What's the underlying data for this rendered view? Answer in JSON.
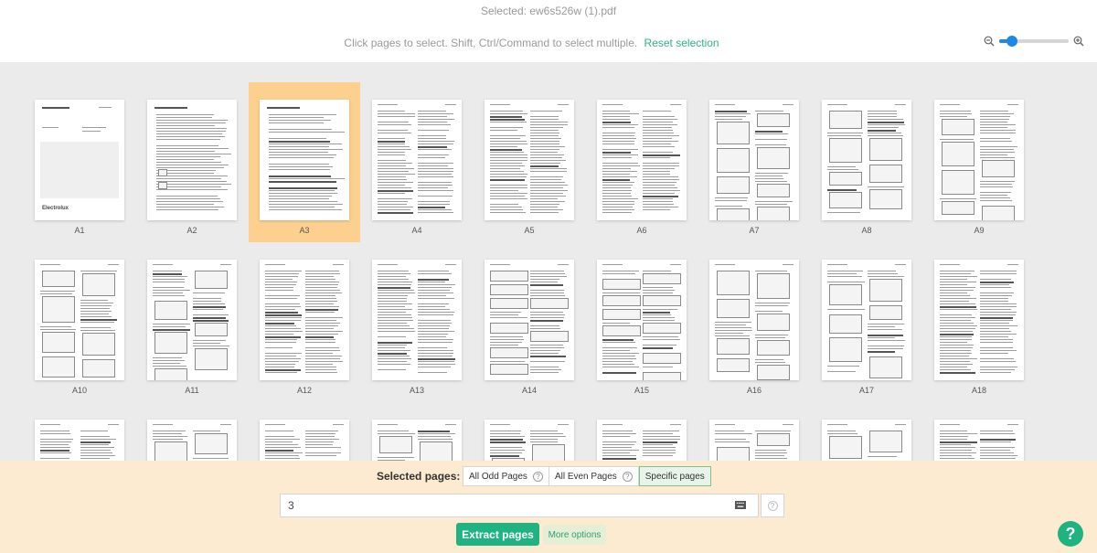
{
  "header": {
    "selected_file": "Selected: ew6s526w (1).pdf",
    "instructions": "Click pages to select. Shift, Ctrl/Command to select multiple.",
    "reset_label": "Reset selection"
  },
  "zoom": {
    "zoom_out_icon": "zoom-out-icon",
    "zoom_in_icon": "zoom-in-icon",
    "level": 0.18
  },
  "pages": [
    {
      "label": "A1",
      "selected": false
    },
    {
      "label": "A2",
      "selected": false
    },
    {
      "label": "A3",
      "selected": true
    },
    {
      "label": "A4",
      "selected": false
    },
    {
      "label": "A5",
      "selected": false
    },
    {
      "label": "A6",
      "selected": false
    },
    {
      "label": "A7",
      "selected": false
    },
    {
      "label": "A8",
      "selected": false
    },
    {
      "label": "A9",
      "selected": false
    },
    {
      "label": "A10",
      "selected": false
    },
    {
      "label": "A11",
      "selected": false
    },
    {
      "label": "A12",
      "selected": false
    },
    {
      "label": "A13",
      "selected": false
    },
    {
      "label": "A14",
      "selected": false
    },
    {
      "label": "A15",
      "selected": false
    },
    {
      "label": "A16",
      "selected": false
    },
    {
      "label": "A17",
      "selected": false
    },
    {
      "label": "A18",
      "selected": false
    },
    {
      "label": "",
      "selected": false
    },
    {
      "label": "",
      "selected": false
    },
    {
      "label": "",
      "selected": false
    },
    {
      "label": "",
      "selected": false
    },
    {
      "label": "",
      "selected": false
    },
    {
      "label": "",
      "selected": false
    },
    {
      "label": "",
      "selected": false
    },
    {
      "label": "",
      "selected": false
    },
    {
      "label": "",
      "selected": false
    }
  ],
  "cover_brand": "Electrolux",
  "selection": {
    "label": "Selected pages:",
    "options": [
      {
        "label": "All Odd Pages",
        "has_help": true,
        "active": false
      },
      {
        "label": "All Even Pages",
        "has_help": true,
        "active": false
      },
      {
        "label": "Specific pages",
        "has_help": false,
        "active": true
      }
    ],
    "input_value": "3",
    "help_glyph": "?"
  },
  "actions": {
    "extract_label": "Extract pages",
    "more_options_label": "More options"
  },
  "help_fab": "?",
  "colors": {
    "accent": "#1fb382",
    "selected_tile": "#fdd08f",
    "panel_bg": "#fcebd0",
    "zoom_blue": "#1e88e5"
  }
}
